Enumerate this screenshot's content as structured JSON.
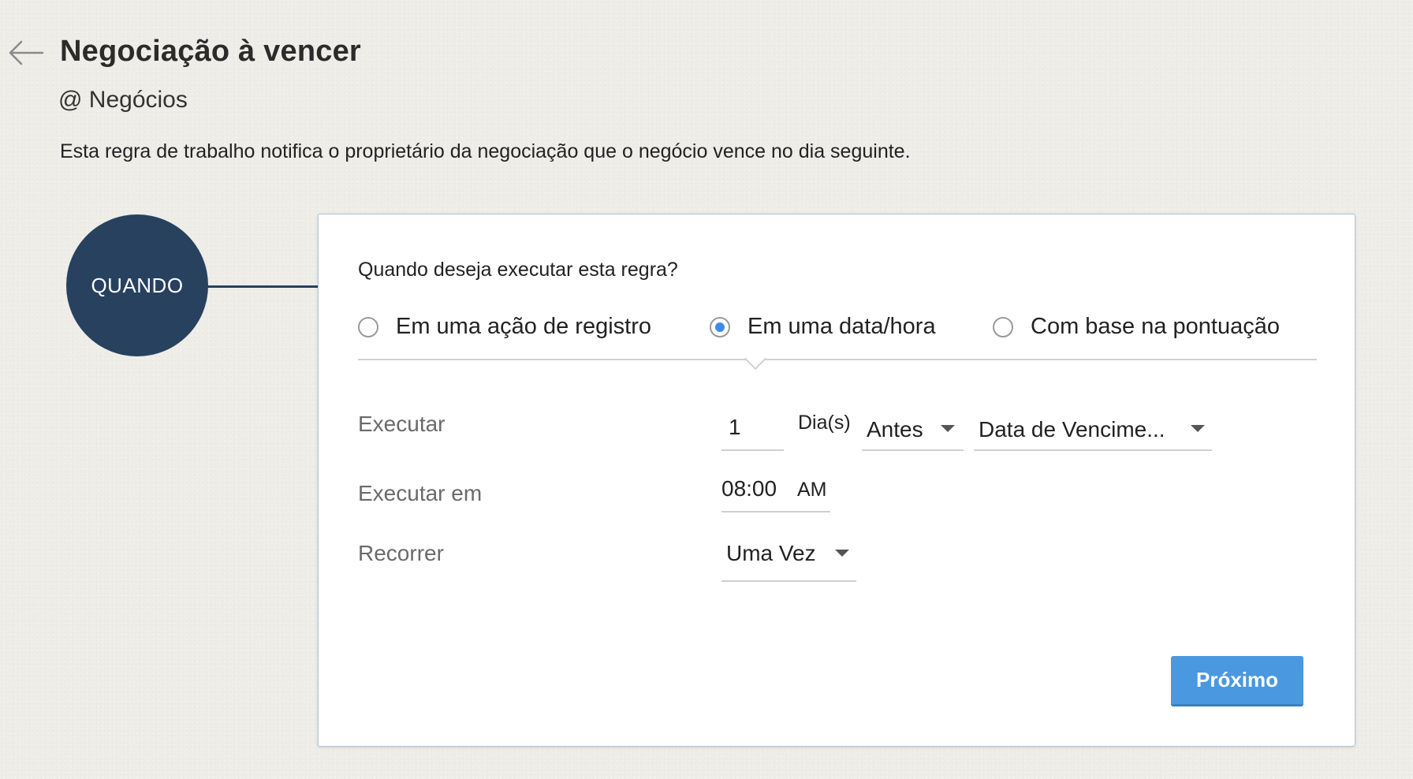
{
  "header": {
    "back_icon": "arrow-left-icon",
    "title": "Negociação à vencer",
    "module": "@ Negócios",
    "description": "Esta regra de trabalho notifica o proprietário da negociação que o negócio vence no dia seguinte."
  },
  "flow": {
    "step_label": "QUANDO",
    "step_color": "#27415f"
  },
  "card": {
    "question": "Quando deseja executar esta regra?",
    "trigger_options": [
      {
        "label": "Em uma ação de registro",
        "selected": false
      },
      {
        "label": "Em uma data/hora",
        "selected": true
      },
      {
        "label": "Com base na pontuação",
        "selected": false
      }
    ],
    "execute": {
      "label": "Executar",
      "value": "1",
      "unit": "Dia(s)",
      "relation": "Antes",
      "field": "Data de Vencime..."
    },
    "execute_at": {
      "label": "Executar em",
      "time": "08:00",
      "period": "AM"
    },
    "recur": {
      "label": "Recorrer",
      "value": "Uma Vez"
    },
    "next_button": "Próximo"
  },
  "colors": {
    "accent": "#4a98e0",
    "radio_selected": "#3d8be8",
    "dark_navy": "#27415f"
  }
}
